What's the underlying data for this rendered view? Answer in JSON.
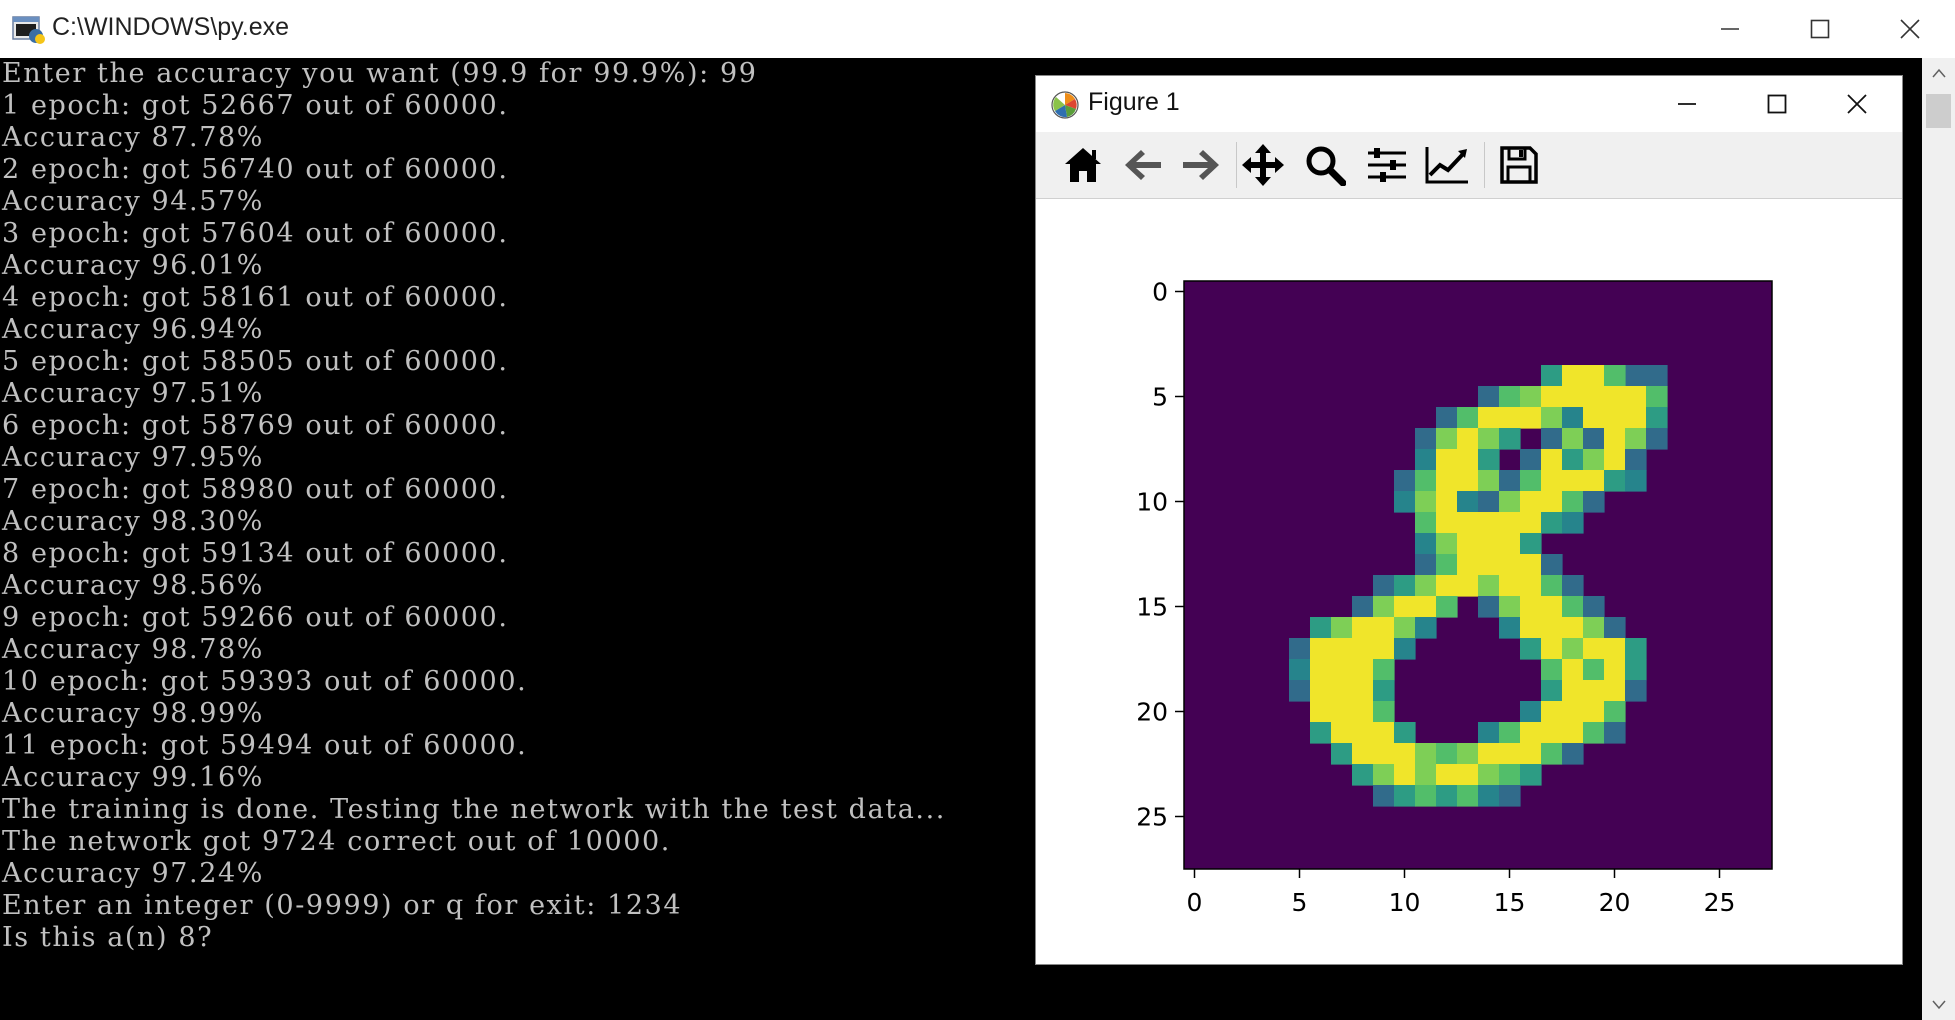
{
  "window": {
    "title": "C:\\WINDOWS\\py.exe"
  },
  "console": {
    "lines": [
      "Enter the accuracy you want (99.9 for 99.9%): 99",
      "1 epoch: got 52667 out of 60000.",
      "Accuracy 87.78%",
      "2 epoch: got 56740 out of 60000.",
      "Accuracy 94.57%",
      "3 epoch: got 57604 out of 60000.",
      "Accuracy 96.01%",
      "4 epoch: got 58161 out of 60000.",
      "Accuracy 96.94%",
      "5 epoch: got 58505 out of 60000.",
      "Accuracy 97.51%",
      "6 epoch: got 58769 out of 60000.",
      "Accuracy 97.95%",
      "7 epoch: got 58980 out of 60000.",
      "Accuracy 98.30%",
      "8 epoch: got 59134 out of 60000.",
      "Accuracy 98.56%",
      "9 epoch: got 59266 out of 60000.",
      "Accuracy 98.78%",
      "10 epoch: got 59393 out of 60000.",
      "Accuracy 98.99%",
      "11 epoch: got 59494 out of 60000.",
      "Accuracy 99.16%",
      "The training is done. Testing the network with the test data...",
      "The network got 9724 correct out of 10000.",
      "Accuracy 97.24%",
      "Enter an integer (0-9999) or q for exit: 1234",
      "Is this a(n) 8?"
    ]
  },
  "figure": {
    "title": "Figure 1",
    "toolbar": [
      "home-icon",
      "back-icon",
      "forward-icon",
      "pan-icon",
      "zoom-icon",
      "configure-subplots-icon",
      "edit-axis-icon",
      "save-icon"
    ]
  },
  "chart_data": {
    "type": "heatmap",
    "title": "",
    "xlabel": "",
    "ylabel": "",
    "rows": 28,
    "cols": 28,
    "xlim": [
      -0.5,
      27.5
    ],
    "ylim": [
      27.5,
      -0.5
    ],
    "xticks": [
      0,
      5,
      10,
      15,
      20,
      25
    ],
    "yticks": [
      0,
      5,
      10,
      15,
      20,
      25
    ],
    "colormap": "viridis",
    "background": "#440154",
    "pixels": [
      [
        4,
        21,
        0.35
      ],
      [
        4,
        22,
        0.35
      ],
      [
        4,
        17,
        0.55
      ],
      [
        4,
        18,
        0.98
      ],
      [
        4,
        19,
        0.98
      ],
      [
        4,
        20,
        0.7
      ],
      [
        5,
        14,
        0.35
      ],
      [
        5,
        15,
        0.7
      ],
      [
        5,
        16,
        0.8
      ],
      [
        5,
        17,
        0.98
      ],
      [
        5,
        18,
        0.98
      ],
      [
        5,
        19,
        0.98
      ],
      [
        5,
        20,
        0.98
      ],
      [
        5,
        21,
        0.98
      ],
      [
        5,
        22,
        0.7
      ],
      [
        6,
        12,
        0.35
      ],
      [
        6,
        13,
        0.7
      ],
      [
        6,
        14,
        0.98
      ],
      [
        6,
        15,
        0.98
      ],
      [
        6,
        16,
        0.98
      ],
      [
        6,
        17,
        0.8
      ],
      [
        6,
        18,
        0.45
      ],
      [
        6,
        19,
        0.98
      ],
      [
        6,
        20,
        0.98
      ],
      [
        6,
        21,
        0.98
      ],
      [
        6,
        22,
        0.55
      ],
      [
        7,
        11,
        0.35
      ],
      [
        7,
        12,
        0.8
      ],
      [
        7,
        13,
        0.98
      ],
      [
        7,
        14,
        0.8
      ],
      [
        7,
        15,
        0.55
      ],
      [
        7,
        17,
        0.35
      ],
      [
        7,
        18,
        0.8
      ],
      [
        7,
        19,
        0.35
      ],
      [
        7,
        20,
        0.98
      ],
      [
        7,
        21,
        0.8
      ],
      [
        7,
        22,
        0.35
      ],
      [
        8,
        11,
        0.45
      ],
      [
        8,
        12,
        0.98
      ],
      [
        8,
        13,
        0.98
      ],
      [
        8,
        14,
        0.55
      ],
      [
        8,
        16,
        0.35
      ],
      [
        8,
        17,
        0.98
      ],
      [
        8,
        18,
        0.55
      ],
      [
        8,
        19,
        0.8
      ],
      [
        8,
        20,
        0.98
      ],
      [
        8,
        21,
        0.35
      ],
      [
        9,
        10,
        0.35
      ],
      [
        9,
        11,
        0.7
      ],
      [
        9,
        12,
        0.98
      ],
      [
        9,
        13,
        0.98
      ],
      [
        9,
        14,
        0.8
      ],
      [
        9,
        15,
        0.35
      ],
      [
        9,
        16,
        0.7
      ],
      [
        9,
        17,
        0.98
      ],
      [
        9,
        18,
        0.98
      ],
      [
        9,
        19,
        0.98
      ],
      [
        9,
        20,
        0.55
      ],
      [
        9,
        21,
        0.45
      ],
      [
        10,
        10,
        0.45
      ],
      [
        10,
        11,
        0.8
      ],
      [
        10,
        12,
        0.98
      ],
      [
        10,
        13,
        0.45
      ],
      [
        10,
        14,
        0.35
      ],
      [
        10,
        15,
        0.8
      ],
      [
        10,
        16,
        0.98
      ],
      [
        10,
        17,
        0.98
      ],
      [
        10,
        18,
        0.7
      ],
      [
        10,
        19,
        0.35
      ],
      [
        11,
        11,
        0.7
      ],
      [
        11,
        12,
        0.98
      ],
      [
        11,
        13,
        0.98
      ],
      [
        11,
        14,
        0.98
      ],
      [
        11,
        15,
        0.98
      ],
      [
        11,
        16,
        0.98
      ],
      [
        11,
        17,
        0.55
      ],
      [
        11,
        18,
        0.45
      ],
      [
        12,
        11,
        0.45
      ],
      [
        12,
        12,
        0.8
      ],
      [
        12,
        13,
        0.98
      ],
      [
        12,
        14,
        0.98
      ],
      [
        12,
        15,
        0.98
      ],
      [
        12,
        16,
        0.55
      ],
      [
        13,
        11,
        0.35
      ],
      [
        13,
        12,
        0.7
      ],
      [
        13,
        13,
        0.98
      ],
      [
        13,
        14,
        0.98
      ],
      [
        13,
        15,
        0.98
      ],
      [
        13,
        16,
        0.98
      ],
      [
        13,
        17,
        0.35
      ],
      [
        14,
        9,
        0.35
      ],
      [
        14,
        10,
        0.55
      ],
      [
        14,
        11,
        0.8
      ],
      [
        14,
        12,
        0.98
      ],
      [
        14,
        13,
        0.98
      ],
      [
        14,
        14,
        0.8
      ],
      [
        14,
        15,
        0.98
      ],
      [
        14,
        16,
        0.98
      ],
      [
        14,
        17,
        0.7
      ],
      [
        14,
        18,
        0.35
      ],
      [
        15,
        8,
        0.35
      ],
      [
        15,
        9,
        0.8
      ],
      [
        15,
        10,
        0.98
      ],
      [
        15,
        11,
        0.98
      ],
      [
        15,
        12,
        0.7
      ],
      [
        15,
        14,
        0.35
      ],
      [
        15,
        15,
        0.8
      ],
      [
        15,
        16,
        0.98
      ],
      [
        15,
        17,
        0.98
      ],
      [
        15,
        18,
        0.7
      ],
      [
        15,
        19,
        0.35
      ],
      [
        16,
        6,
        0.55
      ],
      [
        16,
        7,
        0.8
      ],
      [
        16,
        8,
        0.98
      ],
      [
        16,
        9,
        0.98
      ],
      [
        16,
        10,
        0.8
      ],
      [
        16,
        11,
        0.45
      ],
      [
        16,
        15,
        0.45
      ],
      [
        16,
        16,
        0.98
      ],
      [
        16,
        17,
        0.98
      ],
      [
        16,
        18,
        0.98
      ],
      [
        16,
        19,
        0.8
      ],
      [
        16,
        20,
        0.35
      ],
      [
        17,
        5,
        0.35
      ],
      [
        17,
        6,
        0.98
      ],
      [
        17,
        7,
        0.98
      ],
      [
        17,
        8,
        0.98
      ],
      [
        17,
        9,
        0.98
      ],
      [
        17,
        10,
        0.45
      ],
      [
        17,
        16,
        0.55
      ],
      [
        17,
        17,
        0.98
      ],
      [
        17,
        18,
        0.8
      ],
      [
        17,
        19,
        0.98
      ],
      [
        17,
        20,
        0.98
      ],
      [
        17,
        21,
        0.55
      ],
      [
        18,
        5,
        0.45
      ],
      [
        18,
        6,
        0.98
      ],
      [
        18,
        7,
        0.98
      ],
      [
        18,
        8,
        0.98
      ],
      [
        18,
        9,
        0.7
      ],
      [
        18,
        17,
        0.7
      ],
      [
        18,
        18,
        0.98
      ],
      [
        18,
        19,
        0.7
      ],
      [
        18,
        20,
        0.98
      ],
      [
        18,
        21,
        0.55
      ],
      [
        19,
        5,
        0.35
      ],
      [
        19,
        6,
        0.98
      ],
      [
        19,
        7,
        0.98
      ],
      [
        19,
        8,
        0.98
      ],
      [
        19,
        9,
        0.55
      ],
      [
        19,
        17,
        0.55
      ],
      [
        19,
        18,
        0.98
      ],
      [
        19,
        19,
        0.98
      ],
      [
        19,
        20,
        0.98
      ],
      [
        19,
        21,
        0.35
      ],
      [
        20,
        6,
        0.98
      ],
      [
        20,
        7,
        0.98
      ],
      [
        20,
        8,
        0.98
      ],
      [
        20,
        9,
        0.7
      ],
      [
        20,
        16,
        0.45
      ],
      [
        20,
        17,
        0.98
      ],
      [
        20,
        18,
        0.98
      ],
      [
        20,
        19,
        0.98
      ],
      [
        20,
        20,
        0.7
      ],
      [
        21,
        6,
        0.55
      ],
      [
        21,
        7,
        0.98
      ],
      [
        21,
        8,
        0.98
      ],
      [
        21,
        9,
        0.98
      ],
      [
        21,
        10,
        0.55
      ],
      [
        21,
        14,
        0.45
      ],
      [
        21,
        15,
        0.7
      ],
      [
        21,
        16,
        0.98
      ],
      [
        21,
        17,
        0.98
      ],
      [
        21,
        18,
        0.98
      ],
      [
        21,
        19,
        0.7
      ],
      [
        21,
        20,
        0.35
      ],
      [
        22,
        7,
        0.55
      ],
      [
        22,
        8,
        0.98
      ],
      [
        22,
        9,
        0.98
      ],
      [
        22,
        10,
        0.98
      ],
      [
        22,
        11,
        0.8
      ],
      [
        22,
        12,
        0.7
      ],
      [
        22,
        13,
        0.8
      ],
      [
        22,
        14,
        0.98
      ],
      [
        22,
        15,
        0.98
      ],
      [
        22,
        16,
        0.98
      ],
      [
        22,
        17,
        0.7
      ],
      [
        22,
        18,
        0.35
      ],
      [
        23,
        8,
        0.55
      ],
      [
        23,
        9,
        0.8
      ],
      [
        23,
        10,
        0.98
      ],
      [
        23,
        11,
        0.8
      ],
      [
        23,
        12,
        0.98
      ],
      [
        23,
        13,
        0.98
      ],
      [
        23,
        14,
        0.8
      ],
      [
        23,
        15,
        0.7
      ],
      [
        23,
        16,
        0.55
      ],
      [
        24,
        9,
        0.35
      ],
      [
        24,
        10,
        0.55
      ],
      [
        24,
        11,
        0.7
      ],
      [
        24,
        12,
        0.55
      ],
      [
        24,
        13,
        0.7
      ],
      [
        24,
        14,
        0.45
      ],
      [
        24,
        15,
        0.35
      ]
    ]
  }
}
